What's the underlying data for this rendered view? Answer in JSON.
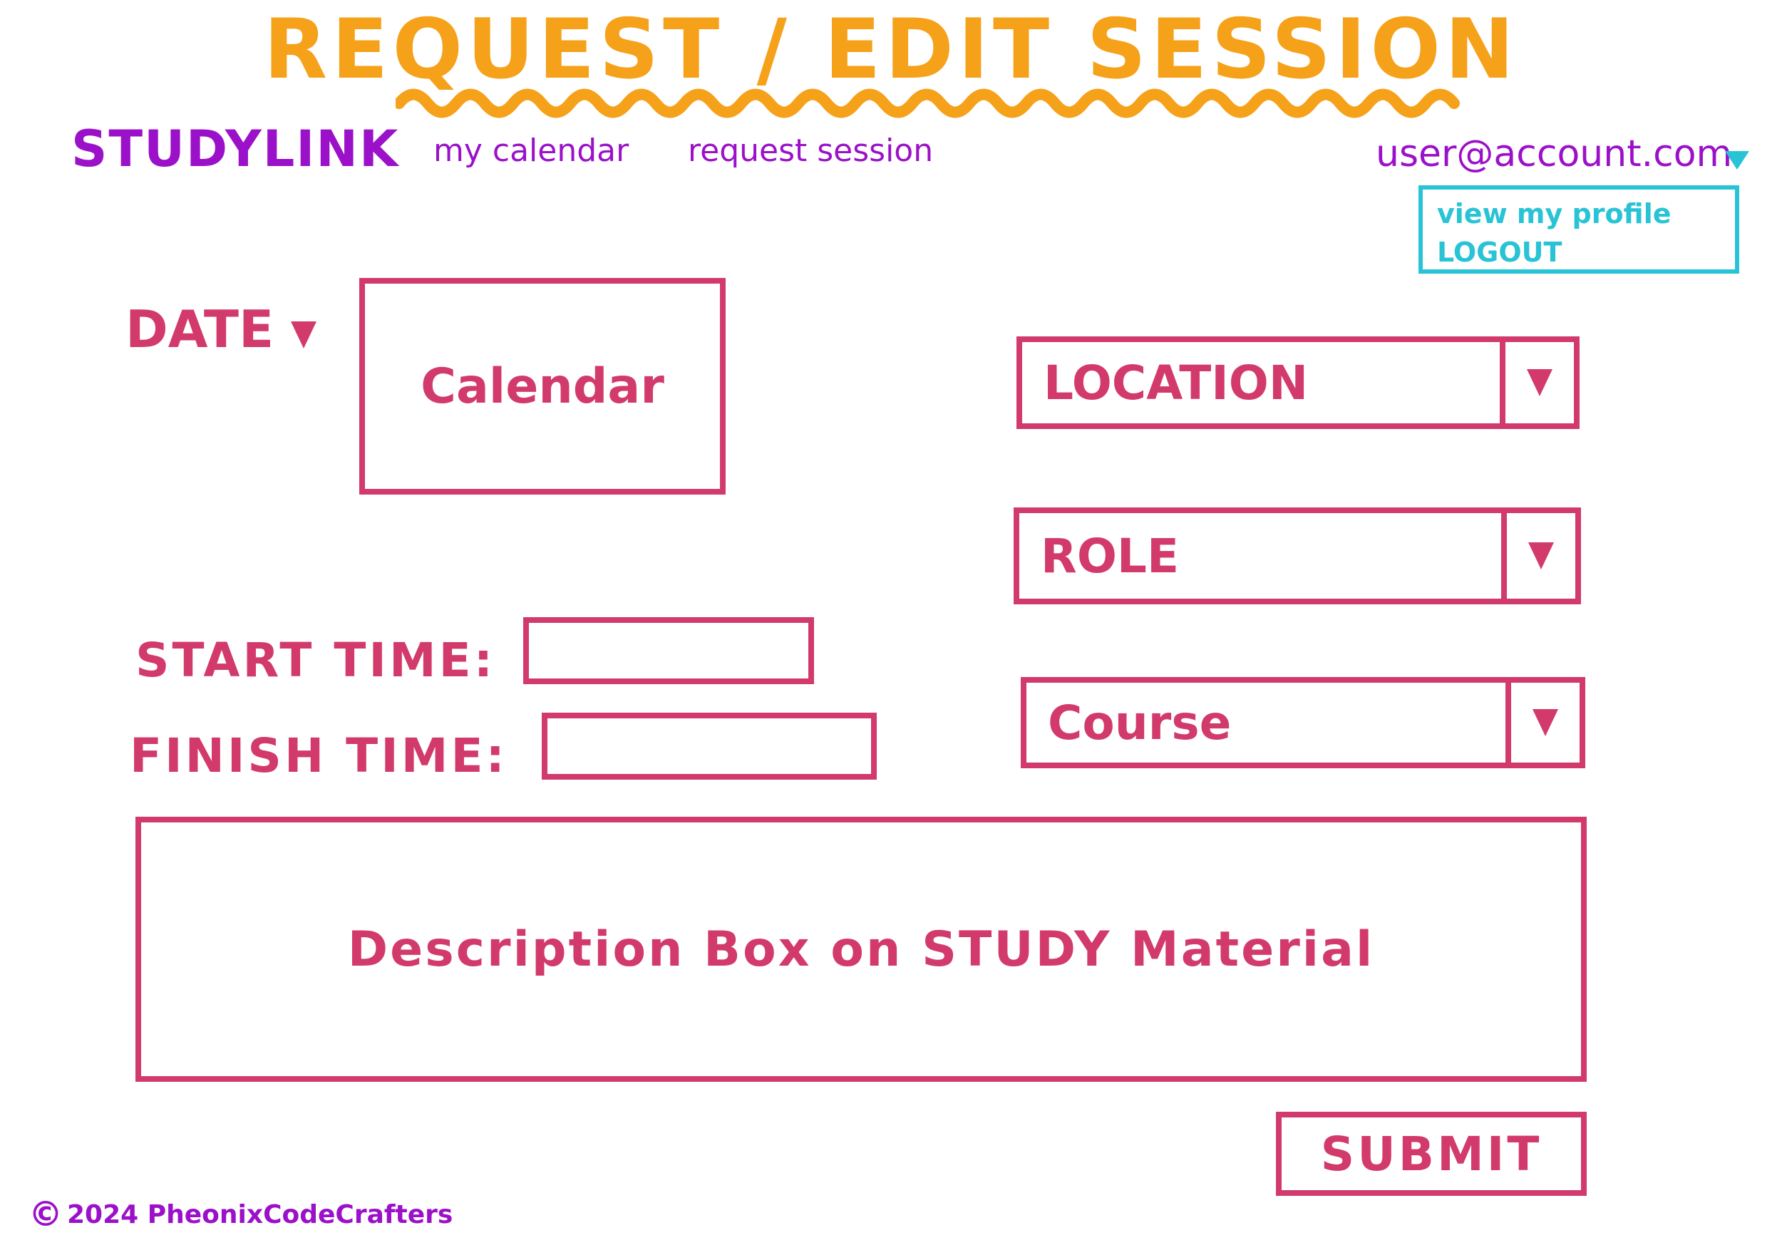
{
  "page": {
    "title": "REQUEST / EDIT SESSION"
  },
  "nav": {
    "brand": "STUDYLINK",
    "links": [
      "my calendar",
      "request session"
    ],
    "user_email": "user@account.com",
    "user_menu": [
      "view my profile",
      "LOGOUT"
    ]
  },
  "form": {
    "date_label": "DATE",
    "calendar_placeholder": "Calendar",
    "start_time_label": "START TIME:",
    "start_time_value": "",
    "finish_time_label": "FINISH TIME:",
    "finish_time_value": "",
    "location_label": "LOCATION",
    "role_label": "ROLE",
    "course_label": "Course",
    "description_placeholder": "Description Box on STUDY Material",
    "submit_label": "SUBMIT"
  },
  "footer": {
    "copyright_symbol": "©",
    "text": "2024 PheonixCodeCrafters"
  },
  "colors": {
    "title": "#f6a11a",
    "nav": "#9b10c9",
    "menu": "#29c3d6",
    "form": "#d23a6c"
  },
  "icons": {
    "dropdown": "caret-down-icon",
    "copyright": "copyright-icon"
  }
}
